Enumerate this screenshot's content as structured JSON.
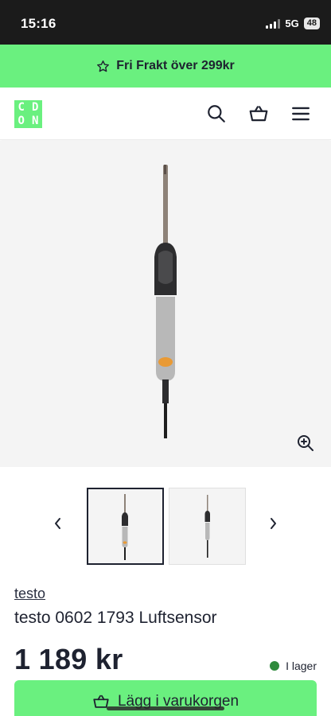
{
  "status_bar": {
    "time": "15:16",
    "network": "5G",
    "battery": "48"
  },
  "promo": {
    "text": "Fri Frakt över 299kr",
    "icon": "star-outline-icon"
  },
  "header": {
    "logo_letters": [
      "C",
      "D",
      "O",
      "N"
    ],
    "icons": [
      "search-icon",
      "basket-icon",
      "menu-icon"
    ]
  },
  "gallery": {
    "zoom_icon": "zoom-in-icon"
  },
  "thumbnails": {
    "count": 2,
    "selected_index": 0
  },
  "product": {
    "brand": "testo",
    "title": "testo 0602 1793 Luftsensor",
    "price": "1 189 kr",
    "stock": "I lager"
  },
  "cart": {
    "label": "Lägg i varukorgen"
  },
  "colors": {
    "accent": "#6af07f",
    "text": "#1e2230",
    "in_stock": "#2f8a3c"
  }
}
